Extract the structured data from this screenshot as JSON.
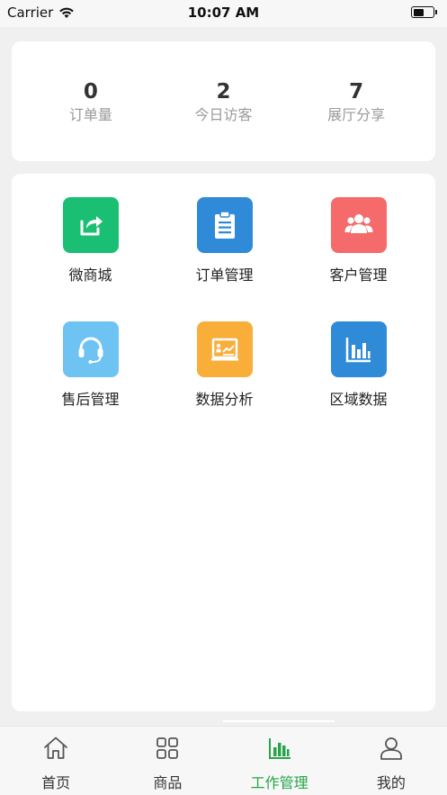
{
  "status_bar": {
    "carrier": "Carrier",
    "time": "10:07 AM"
  },
  "stats": [
    {
      "value": "0",
      "label": "订单量"
    },
    {
      "value": "2",
      "label": "今日访客"
    },
    {
      "value": "7",
      "label": "展厅分享"
    }
  ],
  "grid": [
    {
      "label": "微商城",
      "icon": "share-icon",
      "color": "#1bbf73"
    },
    {
      "label": "订单管理",
      "icon": "clipboard-icon",
      "color": "#2f8ad8"
    },
    {
      "label": "客户管理",
      "icon": "people-icon",
      "color": "#f56a6a"
    },
    {
      "label": "售后管理",
      "icon": "headset-icon",
      "color": "#6ec3f2"
    },
    {
      "label": "数据分析",
      "icon": "analysis-icon",
      "color": "#f9ae3a"
    },
    {
      "label": "区域数据",
      "icon": "bar-chart-icon",
      "color": "#2f8ad8"
    }
  ],
  "tabs": [
    {
      "label": "首页",
      "icon": "home-icon",
      "active": false
    },
    {
      "label": "商品",
      "icon": "grid-icon",
      "active": false
    },
    {
      "label": "工作管理",
      "icon": "bar-chart-icon",
      "active": true
    },
    {
      "label": "我的",
      "icon": "user-icon",
      "active": false
    }
  ],
  "colors": {
    "active_tab": "#27a44a",
    "inactive_tab": "#555555"
  }
}
